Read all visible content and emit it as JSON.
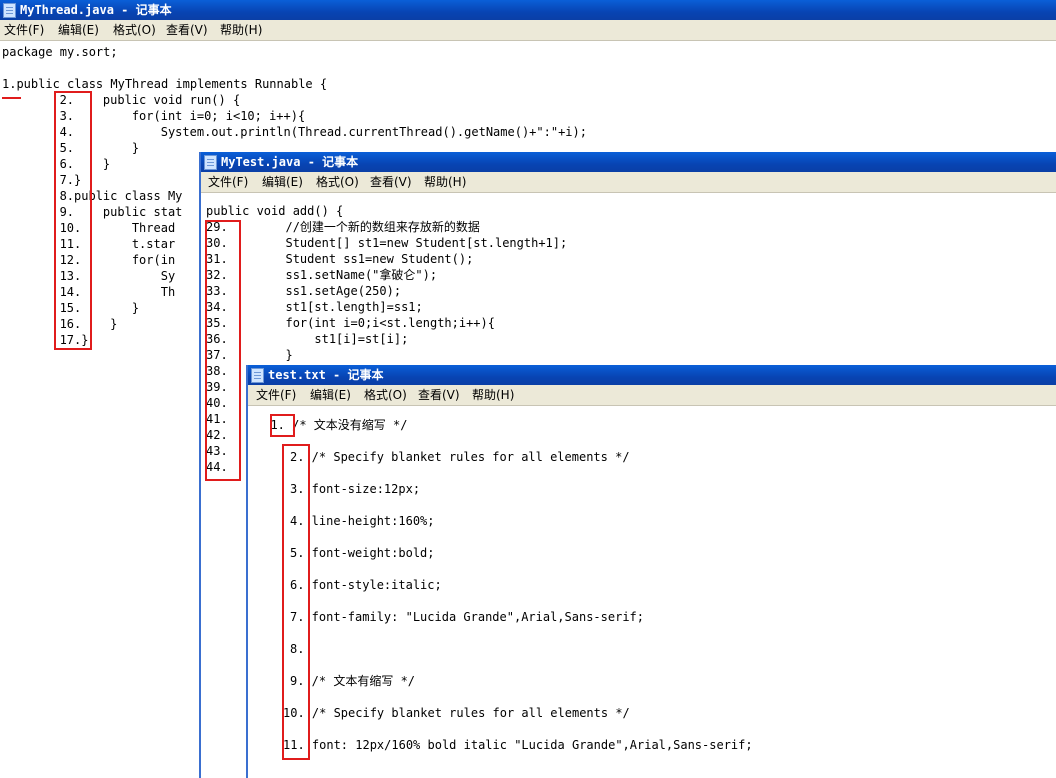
{
  "menu": {
    "file": "文件(F)",
    "edit": "编辑(E)",
    "format": "格式(O)",
    "view": "查看(V)",
    "help": "帮助(H)"
  },
  "window1": {
    "title": "MyThread.java - 记事本",
    "lines": [
      "package my.sort;",
      "",
      "1.public class MyThread implements Runnable {",
      "       2.    public void run() {",
      "       3.        for(int i=0; i<10; i++){",
      "       4.            System.out.println(Thread.currentThread().getName()+\":\"+i);",
      "       5.        }",
      "       6.    }",
      "       7.}",
      "       8.public class My",
      "       9.    public stat",
      "       10.       Thread",
      "       11.       t.star",
      "       12.       for(in",
      "       13.           Sy",
      "       14.           Th",
      "       15.       }",
      "       16.    }",
      "       17.}"
    ]
  },
  "window2": {
    "title": "MyTest.java - 记事本",
    "lines": [
      "public void add() {",
      "29.        //创建一个新的数组来存放新的数据",
      "30.        Student[] st1=new Student[st.length+1];",
      "31.        Student ss1=new Student();",
      "32.        ss1.setName(\"拿破仑\");",
      "33.        ss1.setAge(250);",
      "34.        st1[st.length]=ss1;",
      "35.        for(int i=0;i<st.length;i++){",
      "36.            st1[i]=st[i];",
      "37.        }",
      "38.",
      "39.",
      "40.",
      "41.",
      "42.",
      "43.",
      "44."
    ]
  },
  "window3": {
    "title": "test.txt - 记事本",
    "lines": [
      "  1. /* 文本没有缩写 */",
      "2. /* Specify blanket rules for all elements */",
      "3. font-size:12px;",
      "4. line-height:160%;",
      "5. font-weight:bold;",
      "6. font-style:italic;",
      "7. font-family: \"Lucida Grande\",Arial,Sans-serif;",
      "8.",
      "9. /* 文本有缩写 */",
      "10. /* Specify blanket rules for all elements */",
      "11. font: 12px/160% bold italic \"Lucida Grande\",Arial,Sans-serif;"
    ]
  },
  "colors": {
    "titlebar": "#0a4fc8",
    "menubar": "#ece9d8",
    "annotation": "#e01c1c"
  }
}
